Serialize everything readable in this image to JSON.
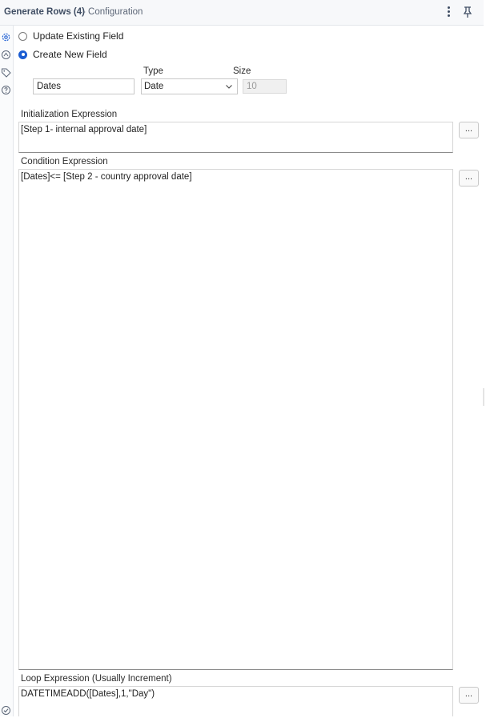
{
  "header": {
    "title": "Generate Rows (4)",
    "subtitle": "- Configuration"
  },
  "sidebar": {
    "icons": [
      "gear-icon",
      "connection-icon",
      "tag-icon",
      "help-icon"
    ],
    "bottom_icon": "check-circle-icon"
  },
  "mode": {
    "update_label": "Update Existing Field",
    "create_label": "Create New  Field",
    "selected": "create"
  },
  "field": {
    "name_value": "Dates",
    "type_label": "Type",
    "type_value": "Date",
    "size_label": "Size",
    "size_value": "10"
  },
  "init_expr": {
    "label": "Initialization Expression",
    "value": "[Step 1- internal approval date]"
  },
  "cond_expr": {
    "label": "Condition Expression",
    "value": "[Dates]<= [Step 2 - country approval date]"
  },
  "loop_expr": {
    "label": "Loop Expression (Usually Increment)",
    "value": "DATETIMEADD([Dates],1,\"Day\")"
  },
  "buttons": {
    "ellipsis": "..."
  },
  "colors": {
    "accent": "#1a5cd2",
    "title_text": "#3f4d63"
  }
}
